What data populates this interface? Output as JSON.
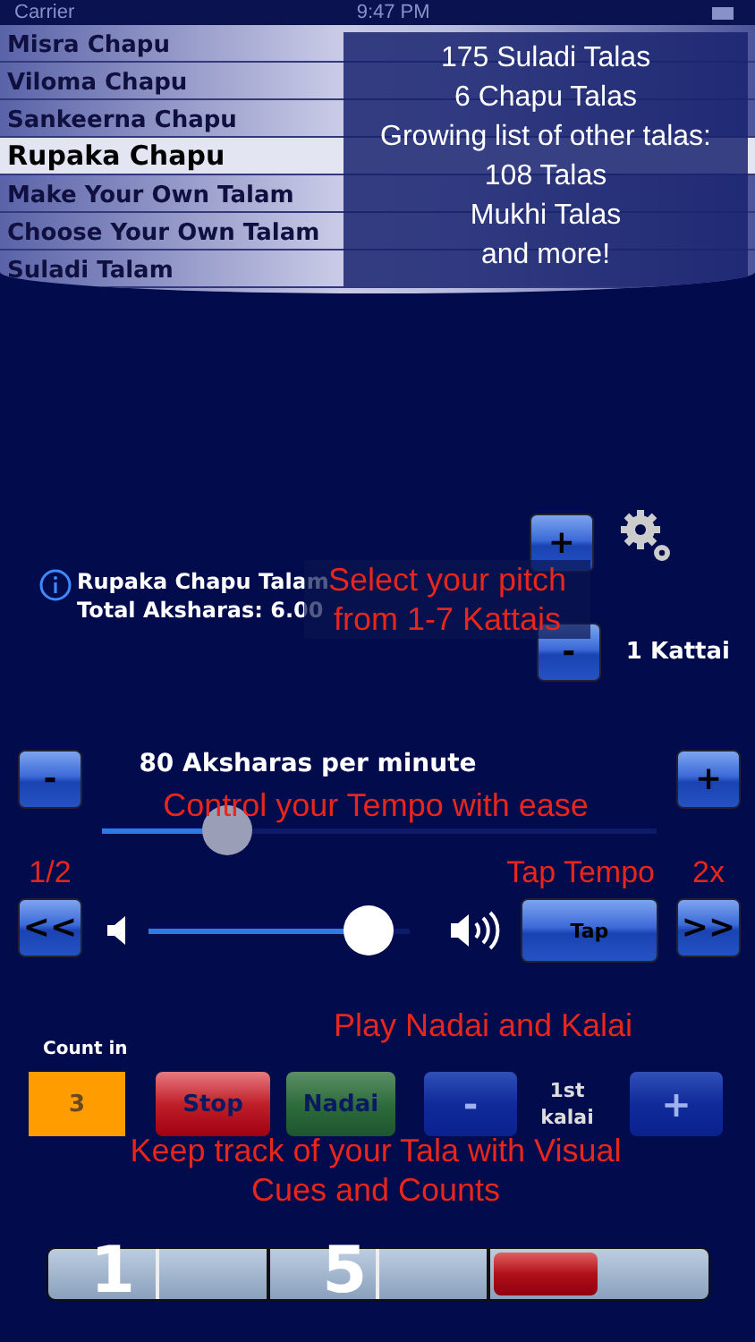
{
  "status_bar": {
    "carrier": "Carrier",
    "time": "9:47 PM"
  },
  "picker": {
    "items": [
      {
        "label": "Misra Chapu",
        "selected": false
      },
      {
        "label": "Viloma Chapu",
        "selected": false
      },
      {
        "label": "Sankeerna Chapu",
        "selected": false
      },
      {
        "label": "Rupaka Chapu",
        "selected": true
      },
      {
        "label": "Make Your Own Talam",
        "selected": false
      },
      {
        "label": "Choose Your Own Talam",
        "selected": false
      },
      {
        "label": "Suladi Talam",
        "selected": false
      }
    ]
  },
  "promo_lines": [
    "175 Suladi Talas",
    "6 Chapu Talas",
    "Growing list of other talas:",
    "108 Talas",
    "Mukhi Talas",
    "and more!"
  ],
  "info": {
    "title": "Rupaka Chapu Talam",
    "total": "Total Aksharas: 6.00"
  },
  "pitch": {
    "plus": "+",
    "minus": "-",
    "value": "1 Kattai",
    "caption": "Select your pitch from 1-7 Kattais"
  },
  "tempo": {
    "minus": "-",
    "label": "80 Aksharas per minute",
    "plus": "+",
    "caption": "Control your Tempo with ease",
    "level": 0.2,
    "half_label": "1/2",
    "half_button": "<<",
    "double_label": "2x",
    "double_button": ">>"
  },
  "volume": {
    "level": 0.92
  },
  "tap": {
    "caption": "Tap Tempo",
    "button": "Tap"
  },
  "controls": {
    "count_in_label": "Count in",
    "count_in": "3",
    "stop": "Stop",
    "nadai": "Nadai",
    "kalai_minus": "-",
    "kalai": "1st kalai",
    "kalai_plus": "+",
    "caption": "Play Nadai and Kalai"
  },
  "beats": {
    "caption": "Keep track of your Tala with Visual Cues and Counts",
    "segments": [
      {
        "count": "1",
        "active": false
      },
      {
        "count": "5",
        "active": false
      },
      {
        "active": true
      }
    ]
  }
}
